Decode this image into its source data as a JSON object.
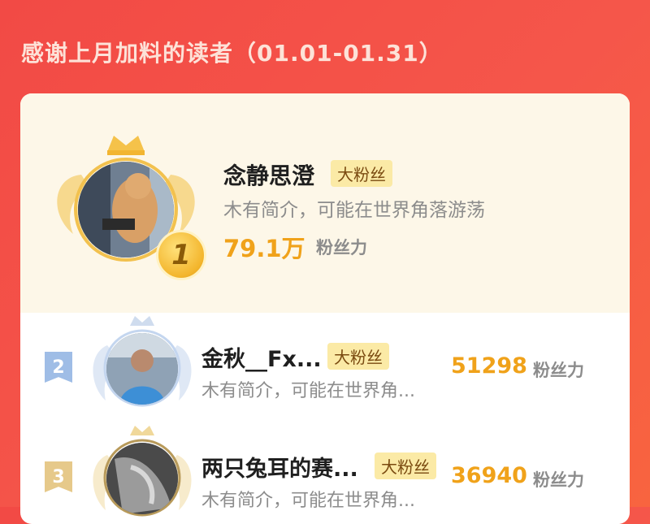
{
  "header": {
    "title": "感谢上月加料的读者（01.01-01.31）"
  },
  "readers": [
    {
      "rank": "1",
      "name": "念静思澄",
      "tag": "大粉丝",
      "bio": "木有简介，可能在世界角落游荡",
      "power": "79.1万",
      "power_label": "粉丝力"
    },
    {
      "rank": "2",
      "name": "金秋__Fx...",
      "tag": "大粉丝",
      "bio": "木有简介，可能在世界角...",
      "power": "51298",
      "power_label": "粉丝力"
    },
    {
      "rank": "3",
      "name": "两只兔耳的赛...",
      "tag": "大粉丝",
      "bio": "木有简介，可能在世界角...",
      "power": "36940",
      "power_label": "粉丝力"
    }
  ],
  "colors": {
    "background": "#f24a45",
    "gold": "#f0a21a",
    "tag_bg": "#fbeaa6",
    "top_card_bg": "#fdf7e8",
    "silver": "#9fbde6",
    "bronze": "#e6c98a"
  },
  "icons": [
    "crown-icon",
    "wing-icon",
    "rank-medal-icon"
  ]
}
